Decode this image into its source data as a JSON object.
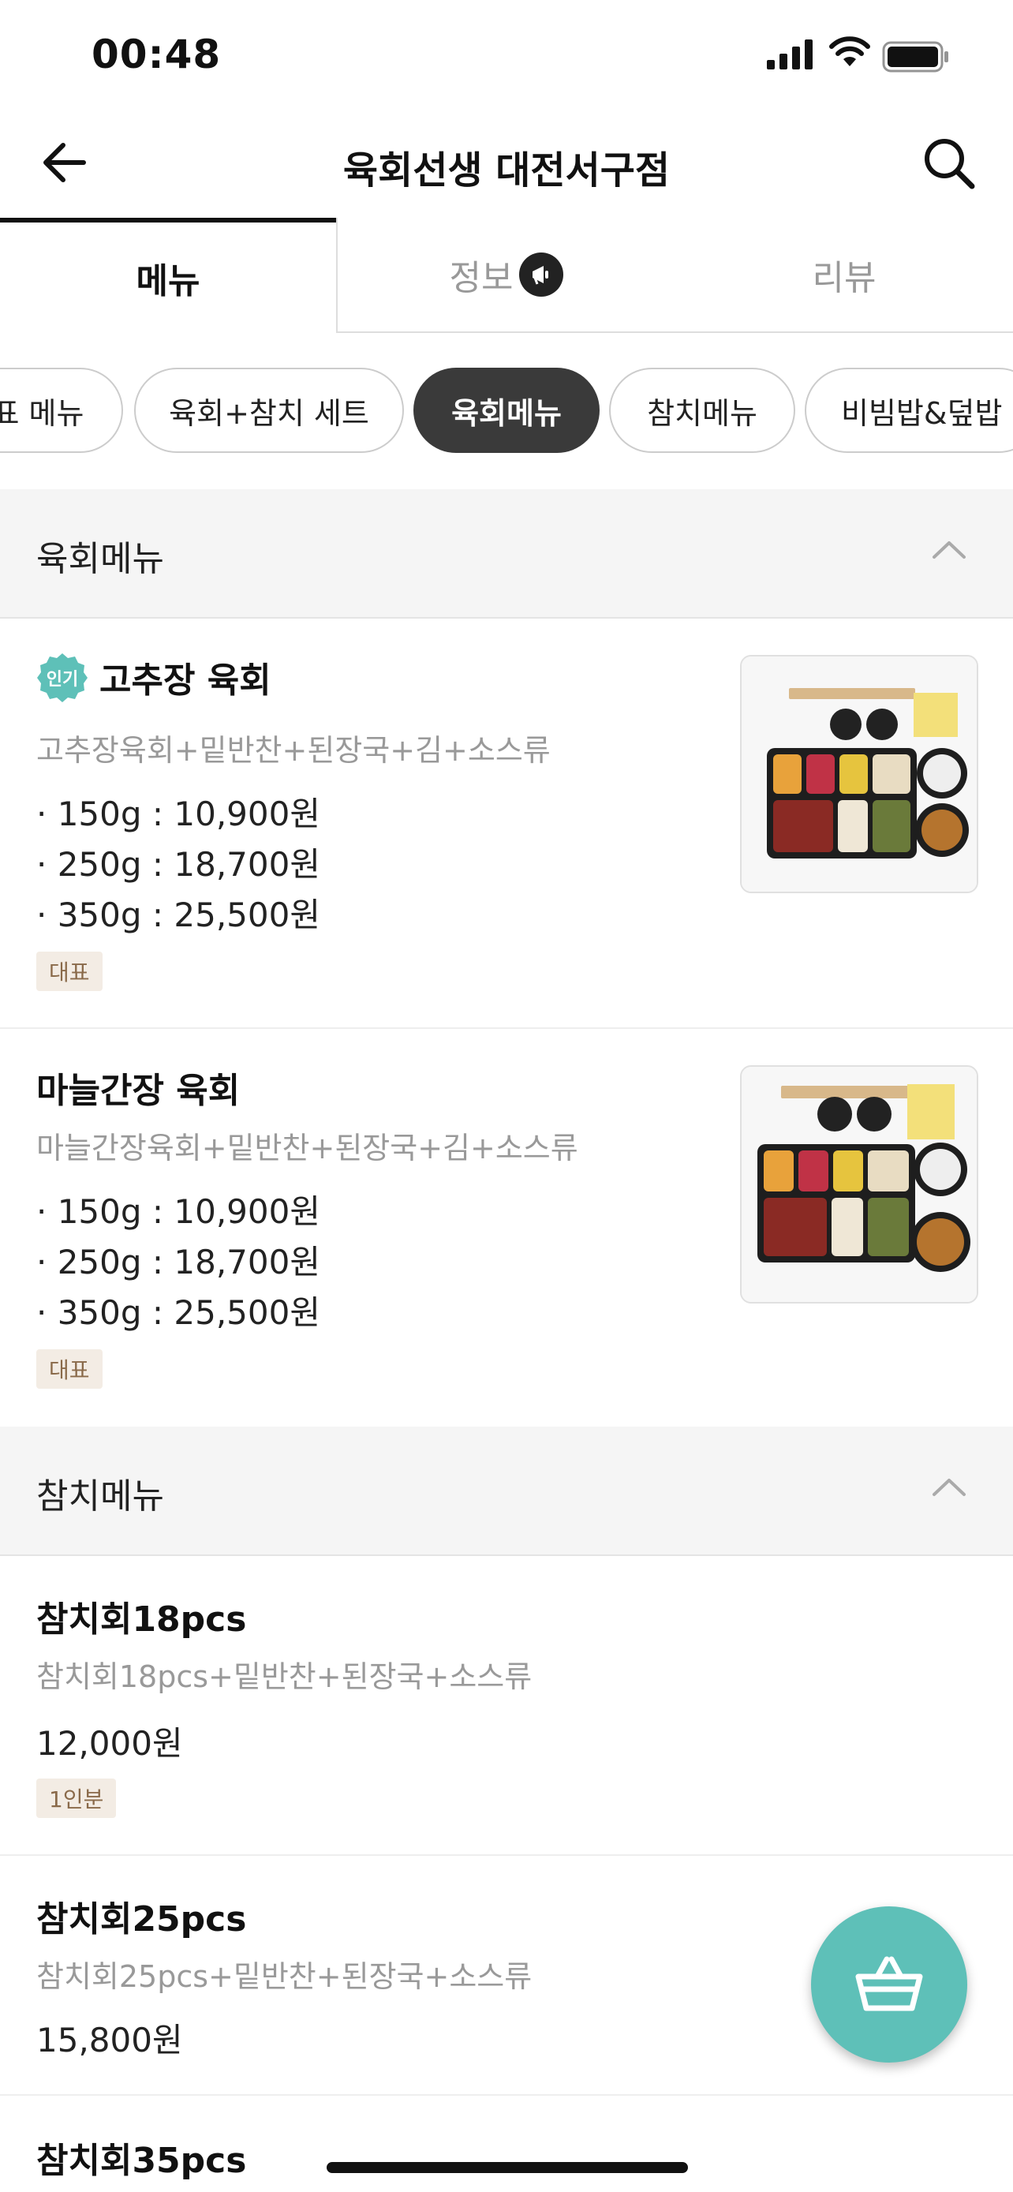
{
  "status": {
    "time": "00:48"
  },
  "header": {
    "title": "육회선생 대전서구점"
  },
  "tabs": {
    "menu": "메뉴",
    "info": "정보",
    "review": "리뷰"
  },
  "chips": [
    "표 메뉴",
    "육회+참치 세트",
    "육회메뉴",
    "참치메뉴",
    "비빔밥&덮밥"
  ],
  "active_chip": "육회메뉴",
  "colors": {
    "accent": "#5ec0b8",
    "chip_active": "#3a3a3a",
    "tag_bg": "#f3ece4",
    "section_bg": "#f5f5f5"
  },
  "sections": {
    "yukhoe": {
      "label": "육회메뉴",
      "items": [
        {
          "badge": "인기",
          "name": "고추장 육회",
          "desc": "고추장육회+밑반찬+된장국+김+소스류",
          "prices": [
            "· 150g : 10,900원",
            "· 250g : 18,700원",
            "· 350g : 25,500원"
          ],
          "tag": "대표"
        },
        {
          "name": "마늘간장 육회",
          "desc": "마늘간장육회+밑반찬+된장국+김+소스류",
          "prices": [
            "· 150g : 10,900원",
            "· 250g : 18,700원",
            "· 350g : 25,500원"
          ],
          "tag": "대표"
        }
      ]
    },
    "tuna": {
      "label": "참치메뉴",
      "items": [
        {
          "name": "참치회18pcs",
          "desc": "참치회18pcs+밑반찬+된장국+소스류",
          "price": "12,000원",
          "tag": "1인분"
        },
        {
          "name": "참치회25pcs",
          "desc": "참치회25pcs+밑반찬+된장국+소스류",
          "price": "15,800원"
        },
        {
          "name": "참치회35pcs"
        }
      ]
    }
  },
  "icons": {
    "back": "arrow-left-icon",
    "search": "search-icon",
    "info_badge": "megaphone-icon",
    "collapse": "chevron-up-icon",
    "cart": "basket-icon"
  }
}
